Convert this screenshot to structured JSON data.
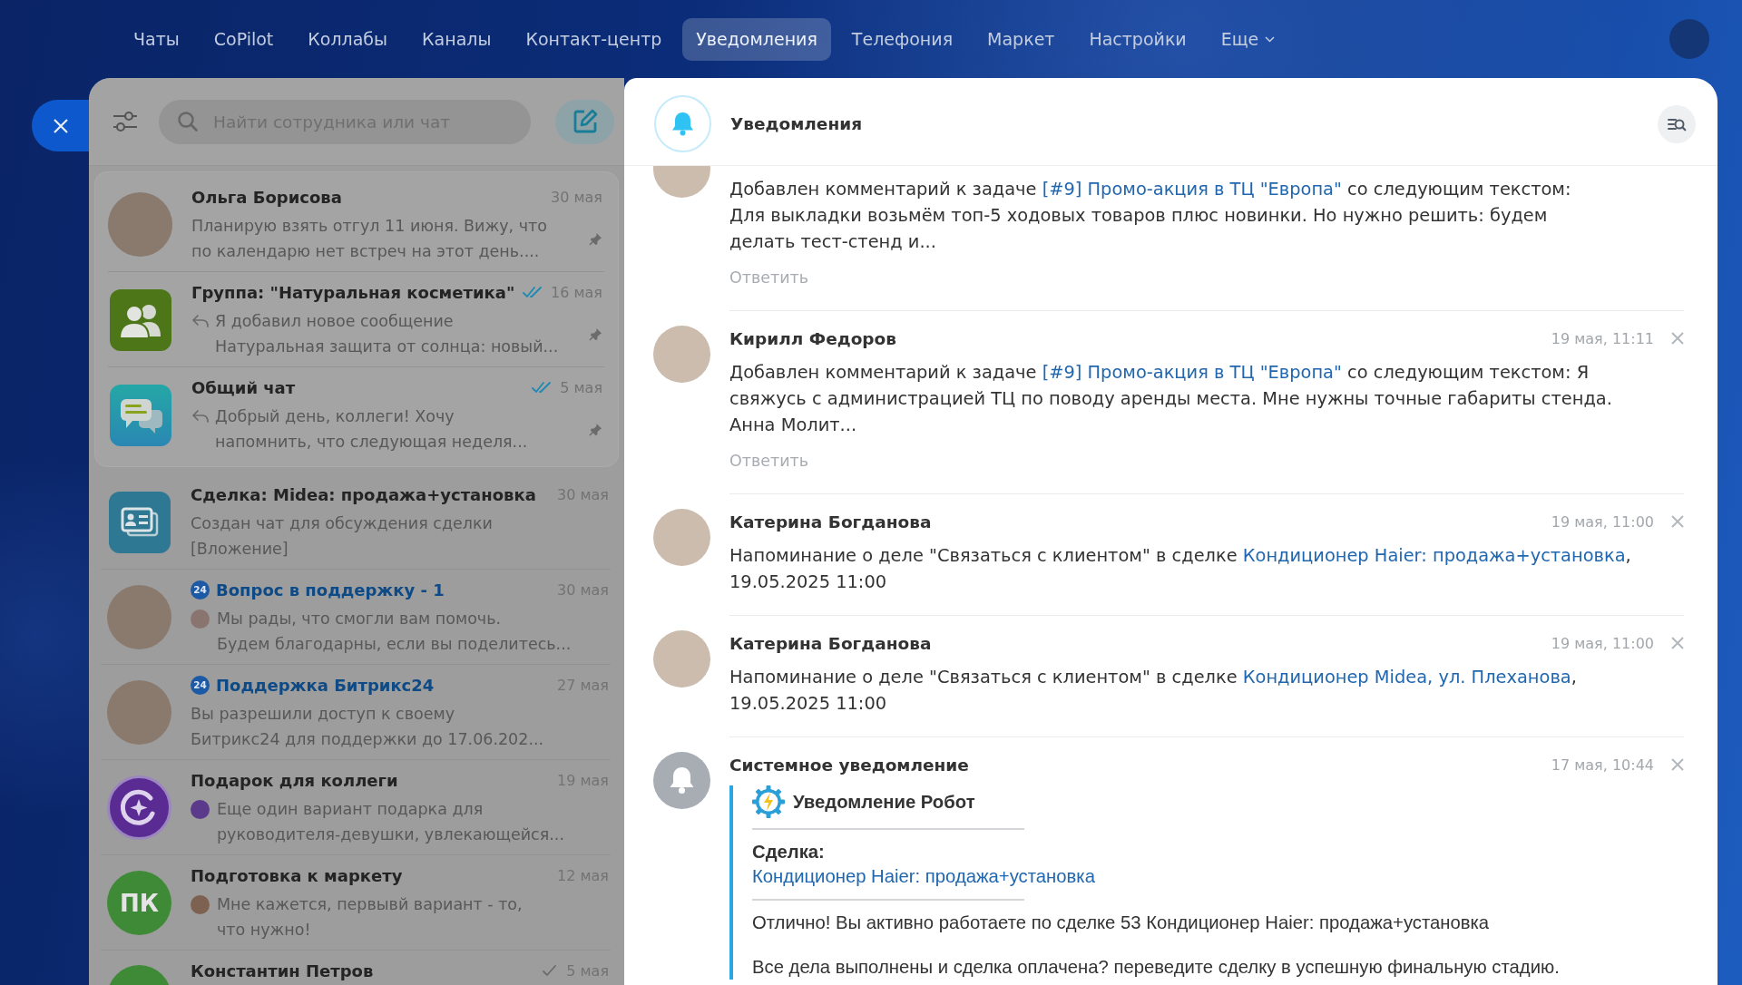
{
  "top_nav": {
    "items": [
      {
        "label": "Чаты",
        "selected": false,
        "kind": "link"
      },
      {
        "label": "CoPilot",
        "selected": false,
        "kind": "link"
      },
      {
        "label": "Коллабы",
        "selected": false,
        "kind": "link"
      },
      {
        "label": "Каналы",
        "selected": false,
        "kind": "link"
      },
      {
        "label": "Контакт-центр",
        "selected": false,
        "kind": "link"
      },
      {
        "label": "Уведомления",
        "selected": true,
        "kind": "link"
      },
      {
        "label": "Телефония",
        "selected": false,
        "kind": "link"
      },
      {
        "label": "Маркет",
        "selected": false,
        "kind": "link"
      },
      {
        "label": "Настройки",
        "selected": false,
        "kind": "link"
      },
      {
        "label": "Еще",
        "selected": false,
        "kind": "dropdown"
      }
    ]
  },
  "chat_panel": {
    "search": {
      "placeholder": "Найти сотрудника или чат"
    },
    "chats": [
      {
        "title": "Ольга Борисова",
        "kind": "chat",
        "avatar": {
          "kind": "photo"
        },
        "date": "30 мая",
        "pinned": true,
        "preview": "Планирую взять отгул 11 июня. Вижу, что\nпо календарю нет встреч на этот день...."
      },
      {
        "title": "Группа: \"Натуральная косметика\"",
        "kind": "chat",
        "avatar": {
          "kind": "group"
        },
        "date": "16 мая",
        "receipt": {
          "read": true
        },
        "pinned": true,
        "prefix": {
          "kind": "reply"
        },
        "preview": "Я добавил новое сообщение\nНатуральная защита от солнца: новый..."
      },
      {
        "title": "Общий чат",
        "kind": "chat",
        "avatar": {
          "kind": "chat"
        },
        "date": "5 мая",
        "receipt": {
          "read": true
        },
        "pinned": true,
        "prefix": {
          "kind": "reply"
        },
        "preview": "Добрый день, коллеги! Хочу\nнапомнить, что следующая неделя..."
      },
      {
        "title": "Сделка: Midea: продажа+установка",
        "kind": "chat",
        "avatar": {
          "kind": "deal"
        },
        "date": "30 мая",
        "pinned": false,
        "preview": "Создан чат для обсуждения сделки\n[Вложение]"
      },
      {
        "title": "Вопрос в поддержку - 1",
        "kind": "support",
        "badge": "24",
        "avatar": {
          "kind": "photo"
        },
        "date": "30 мая",
        "pinned": false,
        "prefix": {
          "kind": "avatar",
          "color": "#8a7470"
        },
        "preview": "Мы рады, что смогли вам помочь.\nБудем благодарны, если вы поделитесь..."
      },
      {
        "title": "Поддержка Битрикс24",
        "kind": "support",
        "badge": "24",
        "avatar": {
          "kind": "photo"
        },
        "date": "27 мая",
        "pinned": false,
        "preview": "Вы разрешили доступ к своему\nБитрикс24 для поддержки до 17.06.202..."
      },
      {
        "title": "Подарок для коллеги",
        "kind": "chat",
        "avatar": {
          "kind": "logo"
        },
        "date": "19 мая",
        "pinned": false,
        "prefix": {
          "kind": "avatar",
          "color": "#5b3a8c"
        },
        "preview": "Еще один вариант подарка для\nруководителя-девушки, увлекающейся..."
      },
      {
        "title": "Подготовка к маркету",
        "kind": "chat",
        "avatar": {
          "kind": "initials",
          "initials": "ПК",
          "color": "#3e8a36"
        },
        "date": "12 мая",
        "pinned": false,
        "prefix": {
          "kind": "avatar",
          "color": "#7d6252"
        },
        "preview": "Мне кажется, первывй вариант - то,\nчто нужно!"
      },
      {
        "title": "Константин Петров",
        "kind": "chat",
        "avatar": {
          "kind": "plain",
          "color": "#3e8a36"
        },
        "date": "5 мая",
        "receipt": {
          "read": false
        },
        "pinned": false
      }
    ]
  },
  "notifications": {
    "title": "Уведомления",
    "items": [
      {
        "kind": "comment",
        "avatar": {
          "kind": "photo"
        },
        "message": [
          {
            "kind": "text",
            "text": "Добавлен комментарий к задаче "
          },
          {
            "kind": "link",
            "text": "[#9] Промо-акция в ТЦ \"Европа\""
          },
          {
            "kind": "text",
            "text": " со следующим текстом:\nДля выкладки возьмём топ-5 ходовых товаров плюс новинки. Но нужно решить: будем\nделать тест-стенд и..."
          }
        ],
        "reply": "Ответить"
      },
      {
        "kind": "comment",
        "avatar": {
          "kind": "photo"
        },
        "author": "Кирилл Федоров",
        "time": "19 мая, 11:11",
        "message": [
          {
            "kind": "text",
            "text": "Добавлен комментарий к задаче "
          },
          {
            "kind": "link",
            "text": "[#9] Промо-акция в ТЦ \"Европа\""
          },
          {
            "kind": "text",
            "text": " со следующим текстом: Я\nсвяжусь с администрацией ТЦ по поводу аренды места. Мне нужны точные габариты стенда.\nАнна Молит..."
          }
        ],
        "reply": "Ответить"
      },
      {
        "kind": "reminder",
        "avatar": {
          "kind": "photo"
        },
        "author": "Катерина Богданова",
        "time": "19 мая, 11:00",
        "message": [
          {
            "kind": "text",
            "text": "Напоминание о деле \"Связаться с клиентом\" в сделке "
          },
          {
            "kind": "link",
            "text": "Кондиционер Haier: продажа+установка"
          },
          {
            "kind": "text",
            "text": ", 19.05.2025 11:00"
          }
        ]
      },
      {
        "kind": "reminder",
        "avatar": {
          "kind": "photo"
        },
        "author": "Катерина Богданова",
        "time": "19 мая, 11:00",
        "message": [
          {
            "kind": "text",
            "text": "Напоминание о деле \"Связаться с клиентом\" в сделке "
          },
          {
            "kind": "link",
            "text": "Кондиционер Midea, ул. Плеханова"
          },
          {
            "kind": "text",
            "text": ", 19.05.2025 11:00"
          }
        ]
      },
      {
        "kind": "system",
        "avatar": {
          "kind": "system"
        },
        "author": "Системное уведомление",
        "time": "17 мая, 10:44",
        "attachment": {
          "title": "Уведомление Робот",
          "field_label": "Сделка:",
          "field_link": "Кондиционер Haier: продажа+установка",
          "paragraphs": [
            "Отлично! Вы активно работаете по сделке 53 Кондиционер Haier: продажа+установка",
            "Все дела выполнены и сделка оплачена? переведите сделку в успешную финальную стадию."
          ]
        }
      }
    ]
  }
}
